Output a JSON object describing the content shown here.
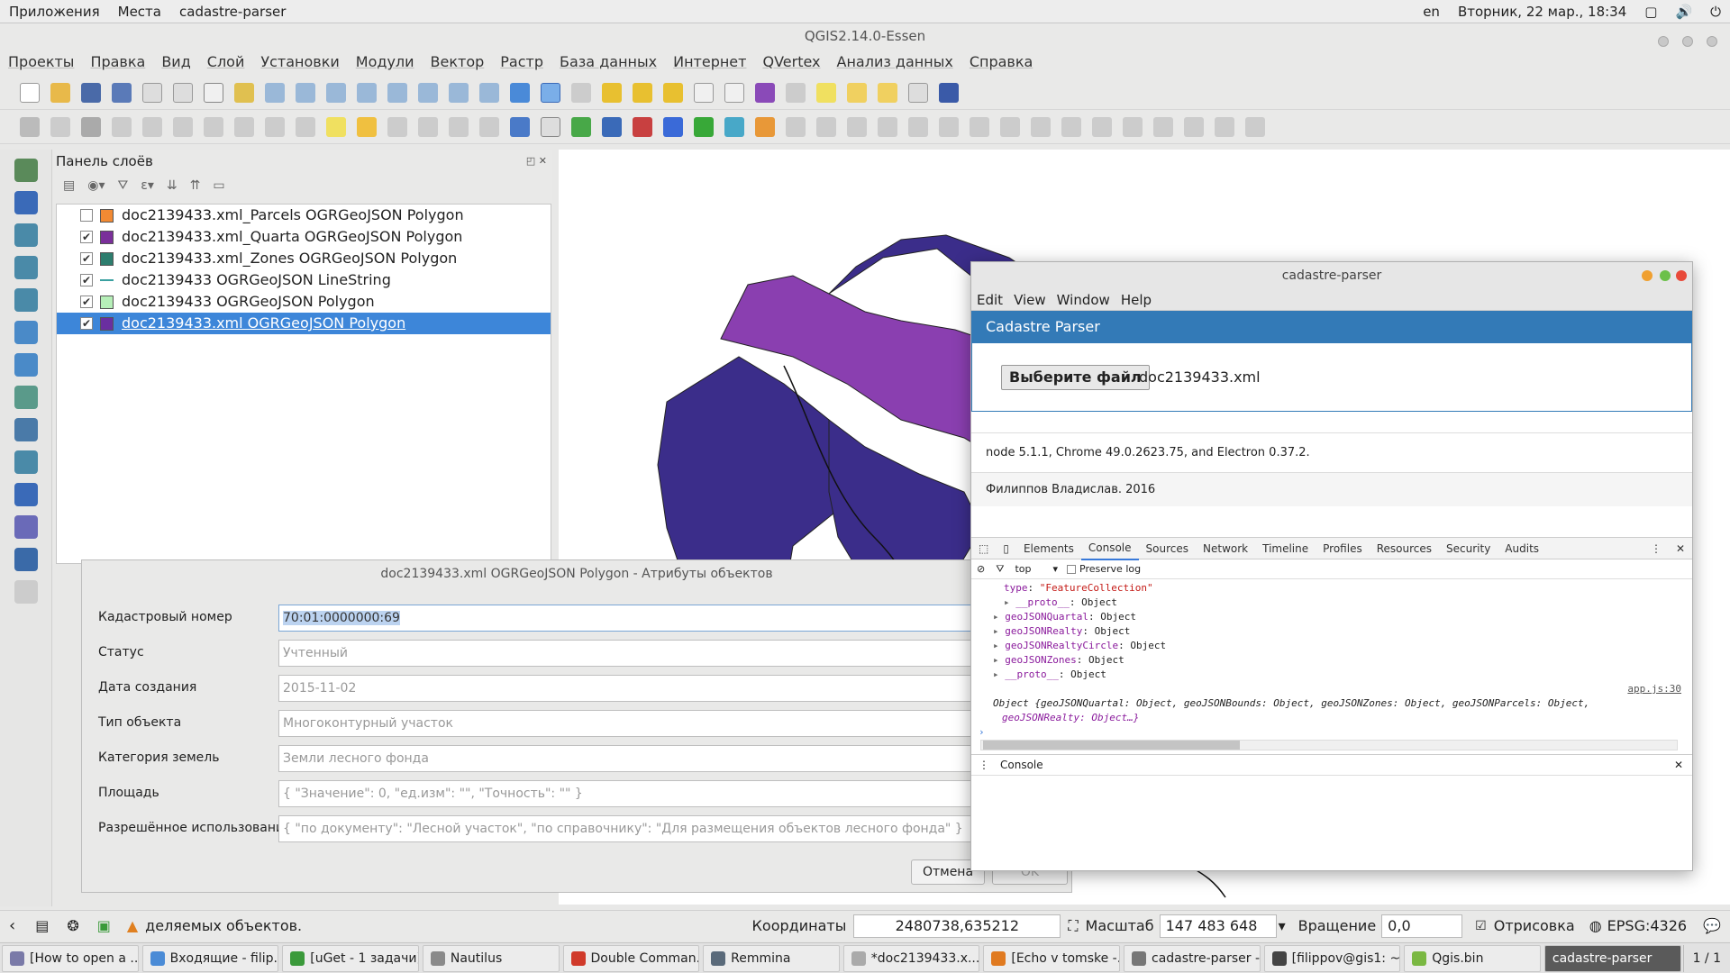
{
  "top_panel": {
    "apps": "Приложения",
    "places": "Места",
    "active_app": "cadastre-parser",
    "lang": "en",
    "datetime": "Вторник, 22 мар., 18:34"
  },
  "qgis": {
    "title": "QGIS2.14.0-Essen",
    "menu": [
      "Проекты",
      "Правка",
      "Вид",
      "Слой",
      "Установки",
      "Модули",
      "Вектор",
      "Растр",
      "База данных",
      "Интернет",
      "QVertex",
      "Анализ данных",
      "Справка"
    ],
    "layers_panel_title": "Панель слоёв",
    "layers": [
      {
        "name": "doc2139433.xml_Parcels OGRGeoJSON Polygon",
        "checked": false,
        "color": "#f28a33",
        "selected": false
      },
      {
        "name": "doc2139433.xml_Quarta OGRGeoJSON Polygon",
        "checked": true,
        "color": "#7a2f9a",
        "selected": false
      },
      {
        "name": "doc2139433.xml_Zones OGRGeoJSON Polygon",
        "checked": true,
        "color": "#2d7d6e",
        "selected": false
      },
      {
        "name": "doc2139433 OGRGeoJSON LineString",
        "checked": true,
        "color": "line",
        "selected": false
      },
      {
        "name": "doc2139433 OGRGeoJSON Polygon",
        "checked": true,
        "color": "#b6efb8",
        "selected": false
      },
      {
        "name": "doc2139433.xml OGRGeoJSON Polygon",
        "checked": true,
        "color": "#6a2fa0",
        "selected": true
      }
    ],
    "attr_dialog": {
      "title": "doc2139433.xml OGRGeoJSON Polygon - Атрибуты объектов",
      "rows": [
        {
          "label": "Кадастровый номер",
          "value": "70:01:0000000:69"
        },
        {
          "label": "Статус",
          "value": "Учтенный"
        },
        {
          "label": "Дата создания",
          "value": "2015-11-02"
        },
        {
          "label": "Тип объекта",
          "value": "Многоконтурный участок"
        },
        {
          "label": "Категория земель",
          "value": "Земли лесного фонда"
        },
        {
          "label": "Площадь",
          "value": "{ \"Значение\": 0, \"ед.изм\": \"\", \"Точность\": \"\" }"
        },
        {
          "label": "Разрешённое использование",
          "value": "{ \"по документу\": \"Лесной участок\", \"по справочнику\": \"Для размещения объектов лесного фонда\" }"
        }
      ],
      "cancel": "Отмена",
      "ok": "OK"
    },
    "status": {
      "message": "деляемых объектов.",
      "coords_label": "Координаты",
      "coords": "2480738,635212",
      "scale_label": "Масштаб",
      "scale": "147 483 648",
      "rotation_label": "Вращение",
      "rotation": "0,0",
      "render_label": "Отрисовка",
      "epsg": "EPSG:4326"
    }
  },
  "cadastre_parser": {
    "title": "cadastre-parser",
    "menu": [
      "Edit",
      "View",
      "Window",
      "Help"
    ],
    "header": "Cadastre Parser",
    "file_button": "Выберите файл",
    "file_name": "doc2139433.xml",
    "versions": "node 5.1.1, Chrome 49.0.2623.75, and Electron 0.37.2.",
    "author": "Филиппов Владислав. 2016",
    "devtools": {
      "tabs": [
        "Elements",
        "Console",
        "Sources",
        "Network",
        "Timeline",
        "Profiles",
        "Resources",
        "Security",
        "Audits"
      ],
      "context": "top",
      "preserve_log": "Preserve log",
      "drawer_tab": "Console",
      "source_link": "app.js:30",
      "lines": [
        {
          "indent": 3,
          "key": "type",
          "val": "\"FeatureCollection\"",
          "str": true,
          "arrow": false
        },
        {
          "indent": 3,
          "key": "__proto__",
          "val": "Object",
          "str": false,
          "arrow": true
        },
        {
          "indent": 2,
          "key": "geoJSONQuartal",
          "val": "Object",
          "str": false,
          "arrow": true
        },
        {
          "indent": 2,
          "key": "geoJSONRealty",
          "val": "Object",
          "str": false,
          "arrow": true
        },
        {
          "indent": 2,
          "key": "geoJSONRealtyCircle",
          "val": "Object",
          "str": false,
          "arrow": true
        },
        {
          "indent": 2,
          "key": "geoJSONZones",
          "val": "Object",
          "str": false,
          "arrow": true
        },
        {
          "indent": 2,
          "key": "__proto__",
          "val": "Object",
          "str": false,
          "arrow": true
        }
      ],
      "summary_1": "Object {geoJSONQuartal: Object, geoJSONBounds: Object, geoJSONZones: Object, geoJSONParcels: Object,",
      "summary_2": "geoJSONRealty: Object…}"
    }
  },
  "taskbar": [
    {
      "label": "[How to open a ...",
      "color": "#7a7aa8"
    },
    {
      "label": "Входящие - filip...",
      "color": "#4a8bd6"
    },
    {
      "label": "[uGet - 1 задачи]",
      "color": "#3b9a3b"
    },
    {
      "label": "Nautilus",
      "color": "#8a8a8a"
    },
    {
      "label": "Double Comman...",
      "color": "#d03a2a"
    },
    {
      "label": "Remmina",
      "color": "#5a6a7a"
    },
    {
      "label": "*doc2139433.x...",
      "color": "#aaaaaa"
    },
    {
      "label": "[Echo v tomske -...",
      "color": "#e07a20"
    },
    {
      "label": "cadastre-parser -...",
      "color": "#777777"
    },
    {
      "label": "[filippov@gis1: ~...",
      "color": "#444444"
    },
    {
      "label": "Qgis.bin",
      "color": "#7ab842"
    },
    {
      "label": "cadastre-parser",
      "color": "#5a5a5a",
      "active": true
    }
  ],
  "workspace": "1 / 1"
}
